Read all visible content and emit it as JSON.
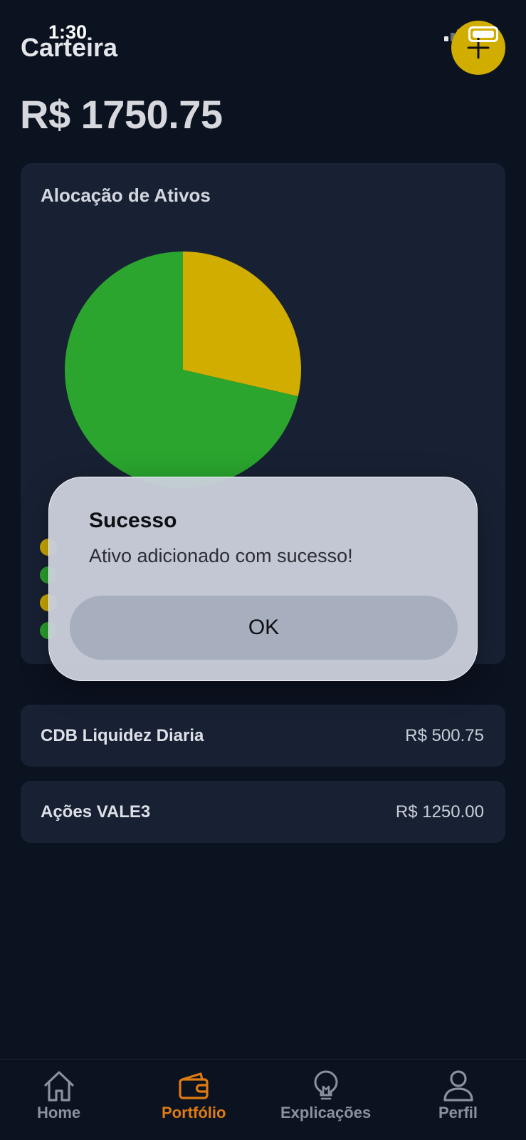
{
  "status": {
    "time": "1:30"
  },
  "header": {
    "title": "Carteira",
    "add_icon": "plus-icon"
  },
  "portfolio": {
    "total": "R$ 1750.75"
  },
  "allocation": {
    "title": "Alocação de Ativos",
    "colors": {
      "cdb": "#d1ad00",
      "acoes": "#2ba52e"
    }
  },
  "chart_data": {
    "type": "pie",
    "title": "Alocação de Ativos",
    "slices": [
      {
        "name": "CDB Liquidez Diaria",
        "value": 500.75,
        "color": "#d1ad00"
      },
      {
        "name": "Ações VALE3",
        "value": 1250.0,
        "color": "#2ba52e"
      }
    ]
  },
  "assets": [
    {
      "name": "CDB Liquidez Diaria",
      "value": "R$ 500.75"
    },
    {
      "name": "Ações VALE3",
      "value": "R$ 1250.00"
    }
  ],
  "nav": {
    "items": [
      {
        "label": "Home",
        "icon": "home-icon"
      },
      {
        "label": "Portfólio",
        "icon": "wallet-icon",
        "active": true
      },
      {
        "label": "Explicações",
        "icon": "lightbulb-icon"
      },
      {
        "label": "Perfil",
        "icon": "user-icon"
      }
    ],
    "active_color": "#e07b12",
    "inactive_color": "#8b919c"
  },
  "dialog": {
    "title": "Sucesso",
    "message": "Ativo adicionado com sucesso!",
    "button": "OK"
  }
}
